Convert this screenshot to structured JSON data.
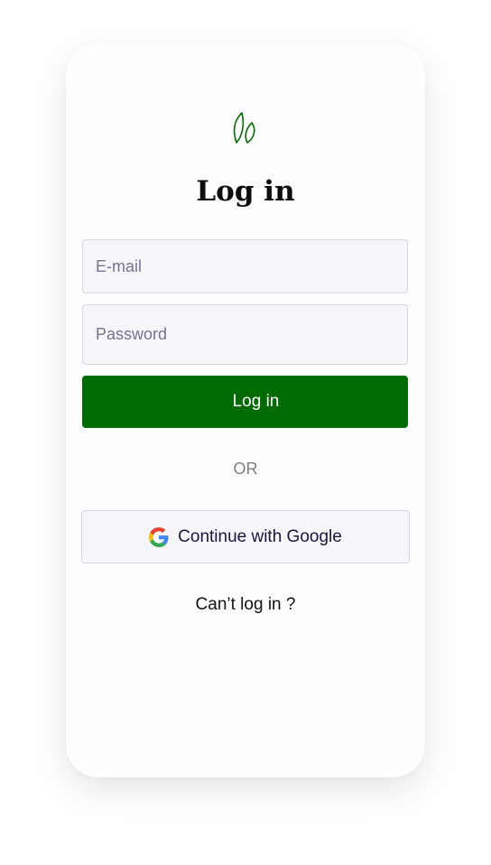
{
  "logo": {
    "icon": "leaf-icon",
    "color": "#036b03"
  },
  "title": "Log in",
  "form": {
    "email_placeholder": "E-mail",
    "password_placeholder": "Password",
    "submit_label": "Log in"
  },
  "divider_text": "OR",
  "google": {
    "label": "Continue with Google",
    "icon": "google-g-icon"
  },
  "forgot_label": "Can’t log in ?",
  "colors": {
    "primary": "#036b03",
    "field_background": "#f6f6fa",
    "field_border": "#d6d6e2"
  }
}
